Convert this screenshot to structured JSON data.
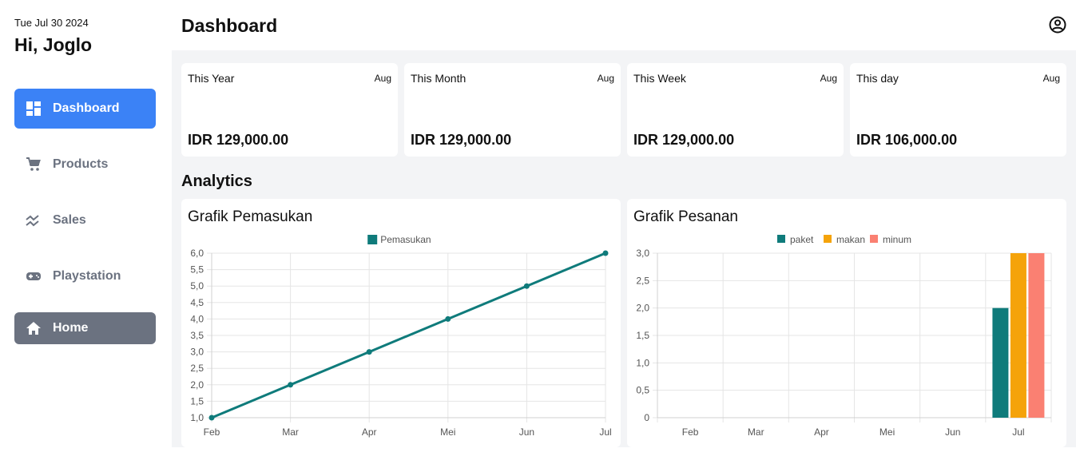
{
  "sidebar": {
    "date": "Tue Jul 30 2024",
    "greeting": "Hi, Joglo",
    "items": [
      {
        "label": "Dashboard",
        "icon": "dashboard-icon"
      },
      {
        "label": "Products",
        "icon": "cart-icon"
      },
      {
        "label": "Sales",
        "icon": "chart-icon"
      },
      {
        "label": "Playstation",
        "icon": "gamepad-icon"
      },
      {
        "label": "Home",
        "icon": "home-icon"
      }
    ]
  },
  "header": {
    "title": "Dashboard"
  },
  "cards": [
    {
      "label": "This Year",
      "period": "Aug",
      "amount": "IDR 129,000.00"
    },
    {
      "label": "This Month",
      "period": "Aug",
      "amount": "IDR 129,000.00"
    },
    {
      "label": "This Week",
      "period": "Aug",
      "amount": "IDR 129,000.00"
    },
    {
      "label": "This day",
      "period": "Aug",
      "amount": "IDR 106,000.00"
    }
  ],
  "analytics": {
    "title": "Analytics"
  },
  "chart_data": [
    {
      "type": "line",
      "title": "Grafik Pemasukan",
      "categories": [
        "Feb",
        "Mar",
        "Apr",
        "Mei",
        "Jun",
        "Jul"
      ],
      "series": [
        {
          "name": "Pemasukan",
          "values": [
            1,
            2,
            3,
            4,
            5,
            6
          ],
          "color": "#0f7b7b"
        }
      ],
      "ylim": [
        1,
        6
      ],
      "yticks": [
        "1,0",
        "1,5",
        "2,0",
        "2,5",
        "3,0",
        "3,5",
        "4,0",
        "4,5",
        "5,0",
        "5,5",
        "6,0"
      ],
      "legend": "top",
      "grid": true
    },
    {
      "type": "bar",
      "title": "Grafik Pesanan",
      "categories": [
        "Feb",
        "Mar",
        "Apr",
        "Mei",
        "Jun",
        "Jul"
      ],
      "series": [
        {
          "name": "paket",
          "values": [
            0,
            0,
            0,
            0,
            0,
            2
          ],
          "color": "#0f7b7b"
        },
        {
          "name": "makan",
          "values": [
            0,
            0,
            0,
            0,
            0,
            3
          ],
          "color": "#f5a30a"
        },
        {
          "name": "minum",
          "values": [
            0,
            0,
            0,
            0,
            0,
            3
          ],
          "color": "#fa8072"
        }
      ],
      "ylim": [
        0,
        3
      ],
      "yticks": [
        "0",
        "0,5",
        "1,0",
        "1,5",
        "2,0",
        "2,5",
        "3,0"
      ],
      "legend": "top",
      "grid": true
    }
  ]
}
